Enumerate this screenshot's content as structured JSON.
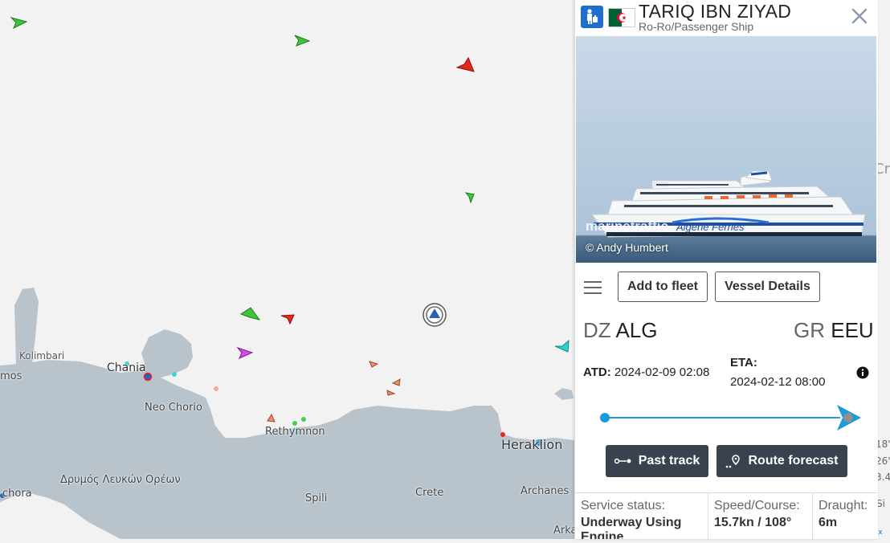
{
  "map": {
    "labels": {
      "kolimbari": "Kolimbari",
      "chania": "Chania",
      "mos": "mos",
      "neo_chorio": "Neo Chorio",
      "rethymnon": "Rethymnon",
      "heraklion": "Heraklion",
      "drymos": "Δρυμός Λευκών Ορέων",
      "chora": "chora",
      "spili": "Spili",
      "crete": "Crete",
      "archanes": "Archanes",
      "arka": "Arka"
    },
    "right_edge": {
      "cr": "Cr",
      "l1": "18'",
      "l2": "26'",
      "l3": "3.4",
      "si": "Si",
      "ox": "ox"
    }
  },
  "vessel": {
    "name": "TARIQ IBN ZIYAD",
    "type": "Ro-Ro/Passenger Ship",
    "photo_credit": "© Andy Humbert",
    "watermark": "marinetraffic",
    "hull_text": "Algerie Ferries"
  },
  "actions": {
    "add_fleet": "Add to fleet",
    "details": "Vessel Details",
    "past_track": "Past track",
    "route_forecast": "Route forecast"
  },
  "voyage": {
    "from_cc": "DZ",
    "from_port": "ALG",
    "to_cc": "GR",
    "to_port": "EEU",
    "atd_label": "ATD:",
    "atd_value": "2024-02-09 02:08",
    "eta_label": "ETA:",
    "eta_value": "2024-02-12 08:00"
  },
  "status": {
    "service_label": "Service status:",
    "service_value": "Underway Using Engine",
    "speed_label": "Speed/Course:",
    "speed_value": "15.7kn / 108°",
    "draught_label": "Draught:",
    "draught_value": "6m"
  },
  "colors": {
    "accent": "#1a9bdb",
    "dark_button": "#3a4250",
    "badge": "#1f6fd1",
    "land": "#b8c3cc",
    "sea": "#f2f2f2"
  }
}
